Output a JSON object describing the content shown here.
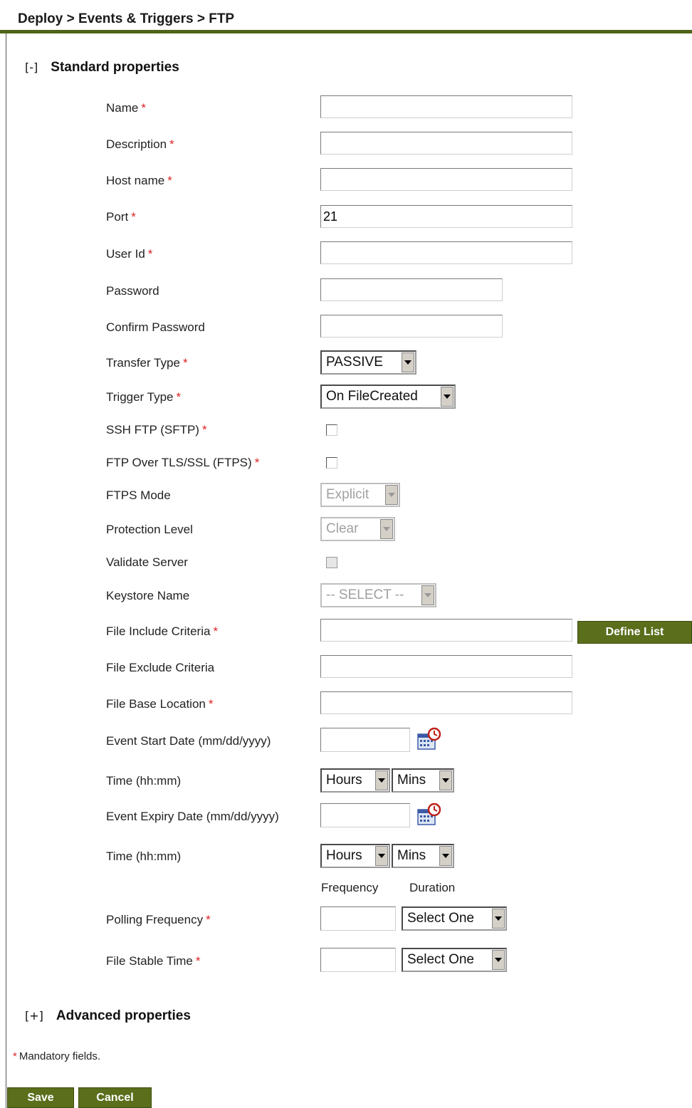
{
  "breadcrumb": "Deploy > Events & Triggers > FTP",
  "standard": {
    "toggle": "[-]",
    "title": "Standard properties"
  },
  "advanced": {
    "toggle": "[+]",
    "title": "Advanced properties"
  },
  "required_marker": "*",
  "fields": {
    "name": {
      "label": "Name",
      "value": ""
    },
    "description": {
      "label": "Description",
      "value": ""
    },
    "host": {
      "label": "Host name",
      "value": ""
    },
    "port": {
      "label": "Port",
      "value": "21"
    },
    "userid": {
      "label": "User Id",
      "value": ""
    },
    "password": {
      "label": "Password",
      "value": ""
    },
    "confirm": {
      "label": "Confirm Password",
      "value": ""
    },
    "transfer": {
      "label": "Transfer Type",
      "value": "PASSIVE"
    },
    "trigger": {
      "label": "Trigger Type",
      "value": "On FileCreated"
    },
    "sftp": {
      "label": "SSH FTP (SFTP)",
      "checked": false
    },
    "ftps": {
      "label": "FTP Over TLS/SSL (FTPS)",
      "checked": false
    },
    "ftps_mode": {
      "label": "FTPS Mode",
      "value": "Explicit"
    },
    "protection": {
      "label": "Protection Level",
      "value": "Clear"
    },
    "validate": {
      "label": "Validate Server",
      "checked": false
    },
    "keystore": {
      "label": "Keystore Name",
      "value": "-- SELECT --"
    },
    "include": {
      "label": "File Include Criteria",
      "value": "",
      "button": "Define List"
    },
    "exclude": {
      "label": "File Exclude Criteria",
      "value": ""
    },
    "base": {
      "label": "File Base Location",
      "value": ""
    },
    "start_date": {
      "label": "Event Start Date  (mm/dd/yyyy)",
      "value": ""
    },
    "start_time": {
      "label": "Time  (hh:mm)",
      "hours": "Hours",
      "mins": "Mins"
    },
    "expiry_date": {
      "label": "Event Expiry Date  (mm/dd/yyyy)",
      "value": ""
    },
    "expiry_time": {
      "label": "Time  (hh:mm)",
      "hours": "Hours",
      "mins": "Mins"
    },
    "polling": {
      "label": "Polling Frequency",
      "value": "",
      "duration": "Select One"
    },
    "stable": {
      "label": "File Stable Time",
      "value": "",
      "duration": "Select One"
    }
  },
  "columns": {
    "frequency": "Frequency",
    "duration": "Duration"
  },
  "footer": {
    "note": "Mandatory fields.",
    "save": "Save",
    "cancel": "Cancel"
  },
  "colors": {
    "accent": "#5a6e1c",
    "required": "#dd2222"
  }
}
